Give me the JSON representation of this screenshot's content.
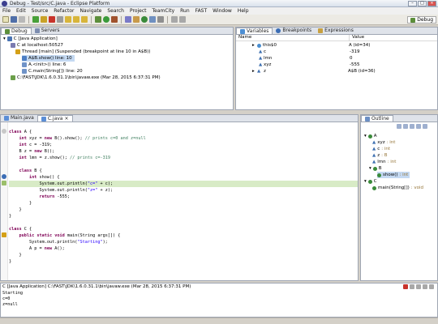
{
  "window": {
    "title": "Debug - Test/src/C.java - Eclipse Platform"
  },
  "menu": [
    "File",
    "Edit",
    "Source",
    "Refactor",
    "Navigate",
    "Search",
    "Project",
    "TeamCity",
    "Run",
    "FAST",
    "Window",
    "Help"
  ],
  "perspective": {
    "label": "Debug"
  },
  "debug_view": {
    "tabs": [
      "Debug",
      "Servers"
    ],
    "tree": [
      "C [Java Application]",
      "C at localhost:50527",
      "Thread [main] (Suspended (breakpoint at line 10 in A$B))",
      "A$B.show() line: 10",
      "A.<init>() line: 6",
      "C.main(String[]) line: 20",
      "C:\\FAST\\JDK\\1.6.0.31.1\\bin\\javaw.exe (Mar 28, 2015 6:37:31 PM)"
    ]
  },
  "variables_view": {
    "tabs": [
      "Variables",
      "Breakpoints",
      "Expressions"
    ],
    "columns": {
      "name": "Name",
      "value": "Value"
    },
    "rows": [
      {
        "name": "this$0",
        "value": "A (id=34)"
      },
      {
        "name": "c",
        "value": "-319"
      },
      {
        "name": "lmn",
        "value": "0"
      },
      {
        "name": "xyz",
        "value": "-555"
      },
      {
        "name": "z",
        "value": "A$B (id=36)"
      }
    ]
  },
  "editor": {
    "tabs": [
      "Main.java",
      "C.java"
    ],
    "lines": [
      "",
      "class A {",
      "    int xyz = new B().show(); // prints c=0 and z=null",
      "    int c = -319;",
      "    B z = new B();",
      "    int lmn = z.show(); // prints c=-319",
      "",
      "    class B {",
      "        int show() {",
      "            System.out.println(\"c=\" + c);",
      "            System.out.println(\"z=\" + z);",
      "            return -555;",
      "        }",
      "    }",
      "}",
      "",
      "class C {",
      "    public static void main(String args[]) {",
      "        System.out.println(\"Starting\");",
      "        A p = new A();",
      "    }",
      "}"
    ]
  },
  "outline_view": {
    "tab": "Outline",
    "items": [
      {
        "label": "A",
        "type": ""
      },
      {
        "label": "xyz",
        "type": " : int"
      },
      {
        "label": "c",
        "type": " : int"
      },
      {
        "label": "z",
        "type": " : B"
      },
      {
        "label": "lmn",
        "type": " : int"
      },
      {
        "label": "B",
        "type": ""
      },
      {
        "label": "show()",
        "type": " : int"
      },
      {
        "label": "C",
        "type": ""
      },
      {
        "label": "main(String[])",
        "type": " : void"
      }
    ]
  },
  "console": {
    "header": "C [Java Application] C:\\FAST\\JDK\\1.6.0.31.1\\bin\\javaw.exe (Mar 28, 2015 6:37:31 PM)",
    "lines": [
      "Starting",
      "c=0",
      "z=null"
    ]
  }
}
